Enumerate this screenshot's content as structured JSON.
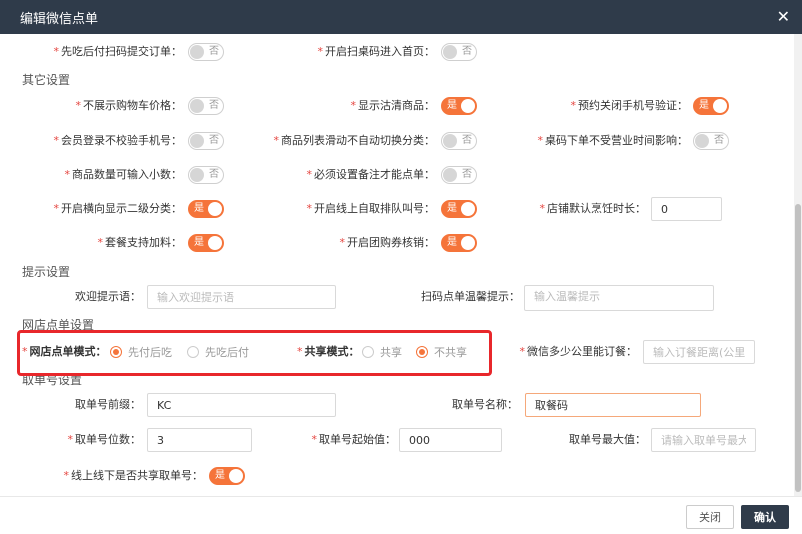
{
  "dialog": {
    "title": "编辑微信点单",
    "close_icon": "close-icon"
  },
  "colors": {
    "accent": "#f5743a",
    "header": "#2f3b4a",
    "highlight": "#e8272b"
  },
  "rows_top": {
    "pay_first": {
      "label": "先吃后付扫码提交订单：",
      "toggle": "否"
    },
    "table_code_home": {
      "label": "开启扫桌码进入首页：",
      "toggle": "否"
    }
  },
  "sections": {
    "other": "其它设置",
    "tips": "提示设置",
    "online": "网店点单设置",
    "pickup": "取单号设置"
  },
  "other": {
    "hide_cart_price": {
      "label": "不展示购物车价格：",
      "toggle": "否"
    },
    "show_sold_out": {
      "label": "显示沽清商品：",
      "toggle": "是"
    },
    "close_phone_verify": {
      "label": "预约关闭手机号验证：",
      "toggle": "是"
    },
    "member_no_phone": {
      "label": "会员登录不校验手机号：",
      "toggle": "否"
    },
    "list_no_switch": {
      "label": "商品列表滑动不自动切换分类：",
      "toggle": "否"
    },
    "table_code_hours": {
      "label": "桌码下单不受营业时间影响：",
      "toggle": "否"
    },
    "qty_decimal": {
      "label": "商品数量可输入小数：",
      "toggle": "否"
    },
    "require_note": {
      "label": "必须设置备注才能点单：",
      "toggle": "否"
    },
    "horizontal_cat": {
      "label": "开启横向显示二级分类：",
      "toggle": "是"
    },
    "online_queue": {
      "label": "开启线上自取排队叫号：",
      "toggle": "是"
    },
    "default_cook_time": {
      "label": "店铺默认烹饪时长：",
      "value": "0"
    },
    "combo_addon": {
      "label": "套餐支持加料：",
      "toggle": "是"
    },
    "group_coupon": {
      "label": "开启团购券核销：",
      "toggle": "是"
    }
  },
  "tips": {
    "welcome": {
      "label": "欢迎提示语：",
      "placeholder": "输入欢迎提示语"
    },
    "scan_tip": {
      "label": "扫码点单温馨提示：",
      "placeholder": "输入温馨提示"
    }
  },
  "online": {
    "mode": {
      "label": "网店点单模式：",
      "options": [
        "先付后吃",
        "先吃后付"
      ],
      "selected": "先付后吃"
    },
    "share": {
      "label": "共享模式：",
      "options": [
        "共享",
        "不共享"
      ],
      "selected": "不共享"
    },
    "distance": {
      "label": "微信多少公里能订餐：",
      "placeholder": "输入订餐距离(公里"
    }
  },
  "pickup": {
    "prefix": {
      "label": "取单号前缀：",
      "value": "KC"
    },
    "name": {
      "label": "取单号名称：",
      "value": "取餐码"
    },
    "digits": {
      "label": "取单号位数：",
      "value": "3"
    },
    "start": {
      "label": "取单号起始值：",
      "value": "000"
    },
    "max": {
      "label": "取单号最大值：",
      "placeholder": "请输入取单号最大"
    },
    "share_online_offline": {
      "label": "线上线下是否共享取单号：",
      "toggle": "是"
    }
  },
  "footer": {
    "close_label": "关闭",
    "ok_label": "确认"
  }
}
